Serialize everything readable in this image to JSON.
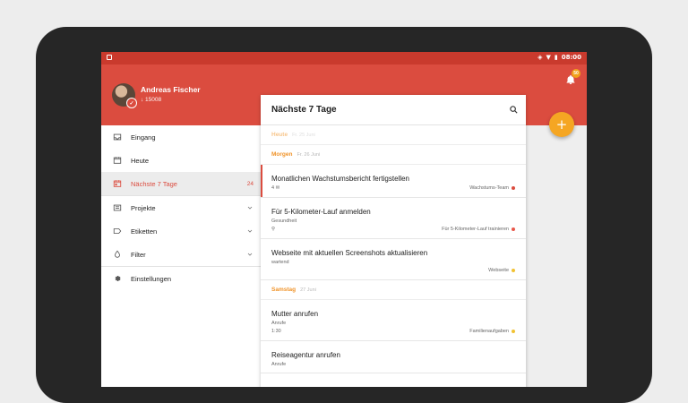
{
  "status_bar": {
    "time": "08:00"
  },
  "notifications": {
    "badge": "50"
  },
  "user": {
    "name": "Andreas Fischer",
    "karma": "↓ 15008"
  },
  "nav": [
    {
      "label": "Eingang",
      "icon": "inbox-icon",
      "count": ""
    },
    {
      "label": "Heute",
      "icon": "calendar-icon",
      "count": ""
    },
    {
      "label": "Nächste 7 Tage",
      "icon": "calendar-week-icon",
      "count": "24",
      "active": true
    },
    {
      "label": "Projekte",
      "icon": "projects-icon",
      "count": ""
    },
    {
      "label": "Etiketten",
      "icon": "label-icon",
      "count": ""
    },
    {
      "label": "Filter",
      "icon": "filter-drop-icon",
      "count": ""
    },
    {
      "label": "Einstellungen",
      "icon": "gear-icon",
      "count": ""
    }
  ],
  "panel": {
    "title": "Nächste 7 Tage",
    "sections": [
      {
        "title": "Heute",
        "date": "Fr. 25 Juni"
      },
      {
        "title": "Morgen",
        "date": "Fr. 26 Juni"
      },
      {
        "title": "Samstag",
        "date": "27 Juni"
      }
    ],
    "tasks": [
      {
        "title": "Monatlichen Wachstumsbericht fertigstellen",
        "sub": "",
        "meta_left": "4 ✉",
        "project": "Wachstums-Team",
        "color": "#db4c3f"
      },
      {
        "title": "Für 5-Kilometer-Lauf anmelden",
        "sub": "Gesundheit",
        "meta_left": "🔗",
        "project": "Für 5-Kilometer-Lauf trainieren",
        "color": "#e8574a"
      },
      {
        "title": "Webseite mit aktuellen Screenshots aktualisieren",
        "sub": "wartend",
        "meta_left": "",
        "project": "Webseite",
        "color": "#f1c232"
      },
      {
        "title": "Mutter anrufen",
        "sub": "Anrufe",
        "meta_left": "1:30",
        "project": "Familienaufgaben",
        "color": "#f1c232"
      },
      {
        "title": "Reiseagentur anrufen",
        "sub": "Anrufe",
        "meta_left": "",
        "project": "",
        "color": ""
      }
    ]
  },
  "fab": {
    "label": "+"
  },
  "colors": {
    "accent": "#db4c3f",
    "section": "#f09329",
    "fab": "#f5a623"
  }
}
